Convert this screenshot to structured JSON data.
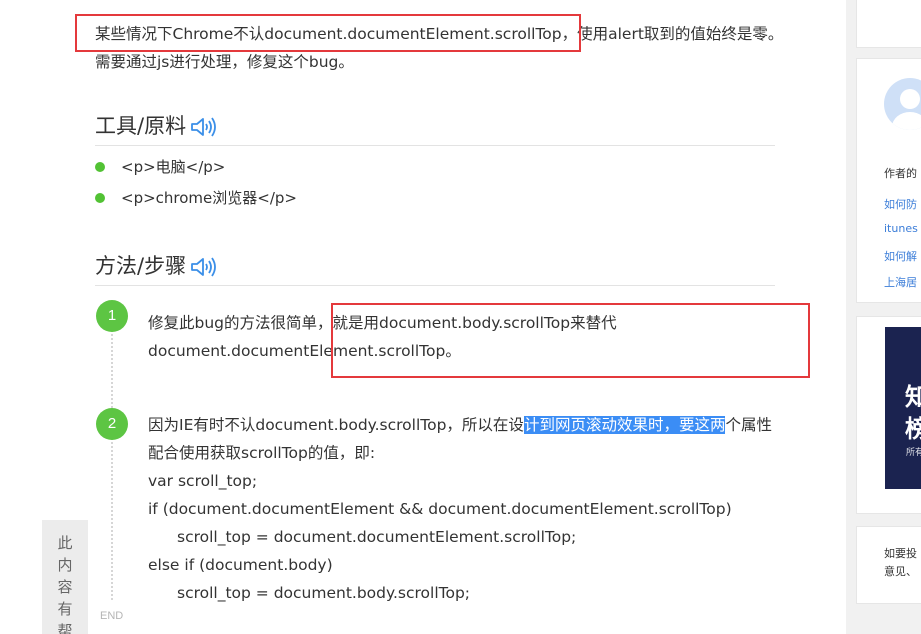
{
  "intro": {
    "part1": "某些情况下Chrome不认document.documentElement.scrollTop",
    "part2": "，使用alert取到的值始终是零。需要通过js进行处理，修复这个bug。"
  },
  "tools": {
    "title": "工具/原料",
    "items": [
      "<p>电脑</p>",
      "<p>chrome浏览器</p>"
    ]
  },
  "method": {
    "title": "方法/步骤",
    "steps": [
      {
        "num": "1",
        "text_a": "修复此bug的方法很简单，",
        "text_b": "就是用document.body.scrollTop来替代document.documentElement.scrollTop。"
      },
      {
        "num": "2",
        "text_a": "因为IE有时不认document.body.scrollTop，所以在设",
        "highlight": "计到网页滚动效果时，要这两",
        "text_b": "个属性配合使用获取scrollTop的值，即:",
        "code": [
          "var scroll_top;",
          "if (document.documentElement && document.documentElement.scrollTop)",
          "scroll_top = document.documentElement.scrollTop;",
          "else if (document.body)",
          "scroll_top = document.body.scrollTop;"
        ]
      }
    ]
  },
  "end_label": "END",
  "helpful_chars": [
    "此",
    "内",
    "容",
    "有",
    "帮"
  ],
  "sidebar": {
    "author_label": "作者的",
    "links": [
      "如何防",
      "itunes",
      "如何解",
      "上海居"
    ],
    "ad": {
      "line1": "知",
      "line2": "榜",
      "small": "所有"
    },
    "feedback": [
      "如要投",
      "意见、"
    ]
  },
  "colors": {
    "accent_red": "#e4393c",
    "step_green": "#5dc543",
    "selection_blue": "#3b8df5",
    "link_blue": "#3b7dd8"
  }
}
